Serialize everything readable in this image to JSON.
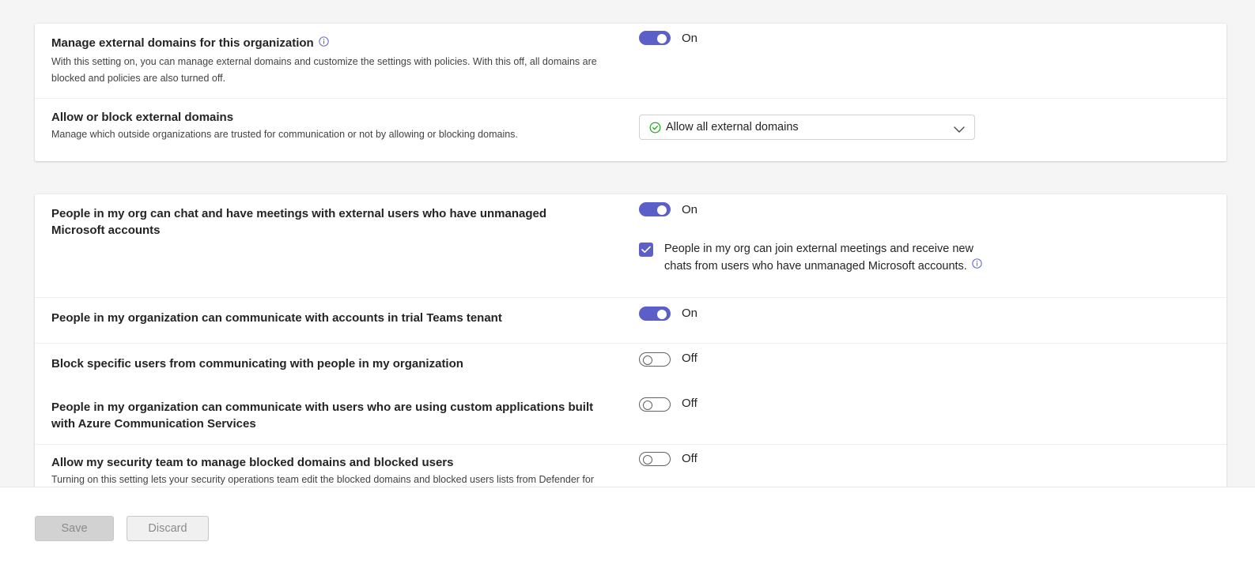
{
  "section1": {
    "manage_domains": {
      "title": "Manage external domains for this organization",
      "description": "With this setting on, you can manage external domains and customize the settings with policies. With this off, all domains are blocked and policies are also turned off.",
      "state": "On"
    },
    "allow_block": {
      "title": "Allow or block external domains",
      "description": "Manage which outside organizations are trusted for communication or not by allowing or blocking domains.",
      "selected": "Allow all external domains"
    }
  },
  "section2": {
    "unmanaged": {
      "title": "People in my org can chat and have meetings with external users who have unmanaged Microsoft accounts",
      "state": "On",
      "checkbox_label": "People in my org can join external meetings and receive new chats from users who have unmanaged Microsoft accounts.",
      "checkbox_checked": true
    },
    "trial": {
      "title": "People in my organization can communicate with accounts in trial Teams tenant",
      "state": "On"
    },
    "block_users": {
      "title": "Block specific users from communicating with people in my organization",
      "state": "Off"
    },
    "acs": {
      "title": "People in my organization can communicate with users who are using custom applications built with Azure Communication Services",
      "state": "Off"
    },
    "security": {
      "title": "Allow my security team to manage blocked domains and blocked users",
      "description": "Turning on this setting lets your security operations team edit the blocked domains and blocked users lists from Defender for",
      "state": "Off"
    }
  },
  "footer": {
    "save_label": "Save",
    "discard_label": "Discard"
  },
  "colors": {
    "accent": "#5b5fc7",
    "success": "#13a10e"
  },
  "icons": {
    "info": "info-icon",
    "check_circle": "check-circle-icon",
    "chevron": "chevron-down-icon",
    "checkmark": "checkmark-icon"
  }
}
